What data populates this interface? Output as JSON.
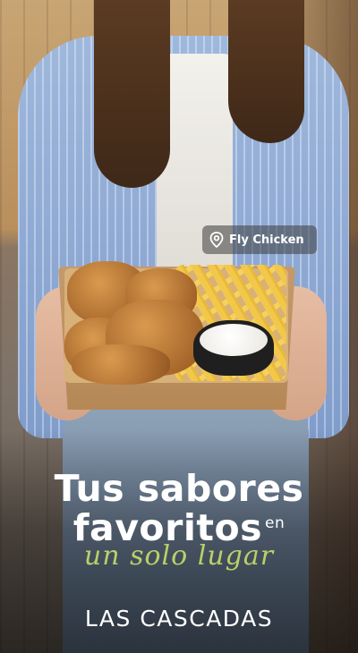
{
  "location_tag": {
    "icon": "map-pin-icon",
    "label": "Fly Chicken"
  },
  "headline": {
    "line1": "Tus sabores",
    "line2": "favoritos",
    "connector": "en",
    "script": "un solo lugar"
  },
  "location_name": "LAS CASCADAS",
  "colors": {
    "accent_script": "#b9d06a",
    "text": "#ffffff",
    "tag_bg": "#3c3c3c"
  }
}
